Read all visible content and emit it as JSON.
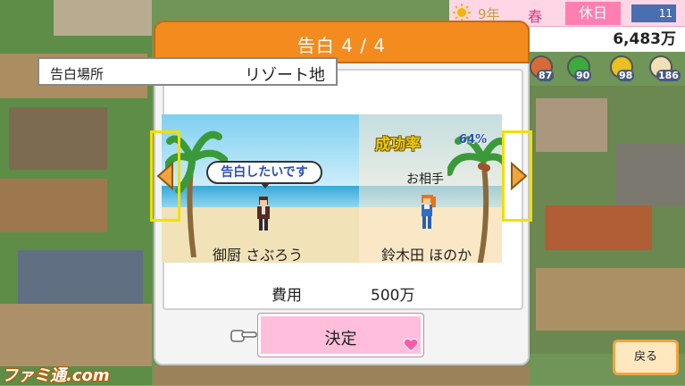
{
  "hud": {
    "year": "9年",
    "season": "春",
    "day_type": "休日",
    "weather_value": "11",
    "money": "6,483万",
    "stats": [
      "87",
      "90",
      "98",
      "186"
    ]
  },
  "dialog": {
    "title": "告白 4 / 4",
    "location_label": "告白場所",
    "location_value": "リゾート地",
    "speech": "告白したいです",
    "success_label": "成功率",
    "success_value": "64%",
    "partner_label": "お相手",
    "left_name": "御厨 さぶろう",
    "right_name": "鈴木田 ほのか",
    "cost_label": "費用",
    "cost_value": "500万",
    "confirm_label": "決定"
  },
  "back_label": "戻る",
  "watermark": "ファミ通.com",
  "colors": {
    "header": "#f38b1f",
    "confirm_button": "#ffbfdc",
    "arrow_frame": "#f0e000",
    "success_text": "#e8c810"
  }
}
